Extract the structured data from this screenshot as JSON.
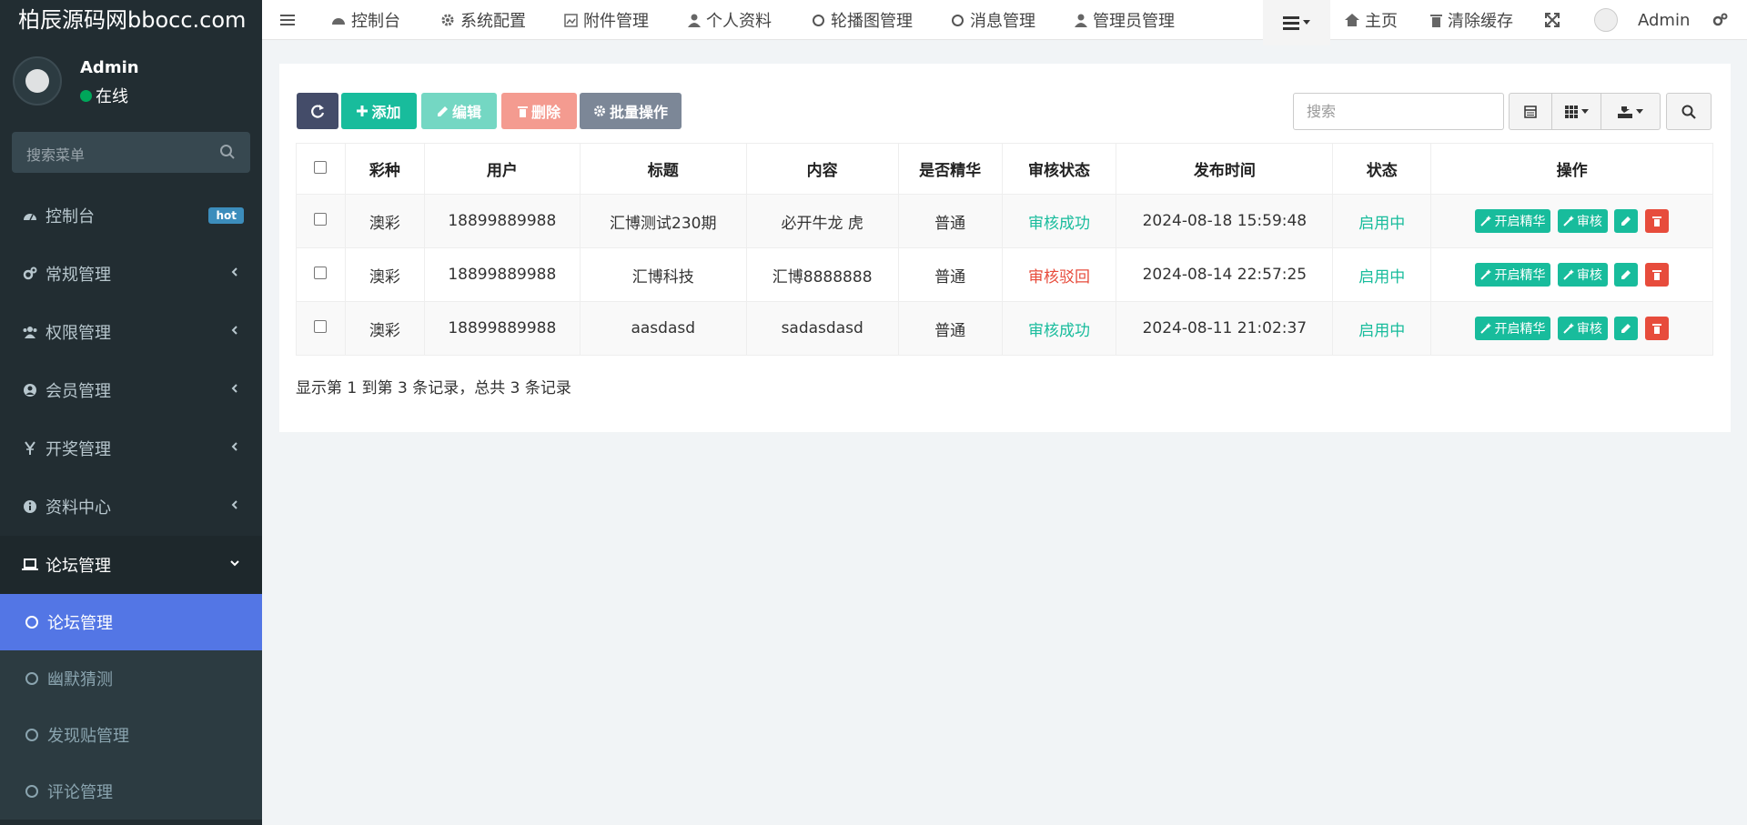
{
  "brand": "柏辰源码网bbocc.com",
  "user": {
    "name": "Admin",
    "status": "在线"
  },
  "sidebar": {
    "search_placeholder": "搜索菜单",
    "items": [
      {
        "label": "控制台",
        "badge": "hot"
      },
      {
        "label": "常规管理"
      },
      {
        "label": "权限管理"
      },
      {
        "label": "会员管理"
      },
      {
        "label": "开奖管理"
      },
      {
        "label": "资料中心"
      },
      {
        "label": "论坛管理"
      }
    ],
    "subitems": [
      {
        "label": "论坛管理"
      },
      {
        "label": "幽默猜测"
      },
      {
        "label": "发现贴管理"
      },
      {
        "label": "评论管理"
      }
    ]
  },
  "topnav": {
    "tabs": [
      "控制台",
      "系统配置",
      "附件管理",
      "个人资料",
      "轮播图管理",
      "消息管理",
      "管理员管理"
    ],
    "home": "主页",
    "clear_cache": "清除缓存",
    "admin": "Admin"
  },
  "toolbar": {
    "add": "添加",
    "edit": "编辑",
    "delete": "删除",
    "batch": "批量操作",
    "search_placeholder": "搜索"
  },
  "table": {
    "headers": [
      "彩种",
      "用户",
      "标题",
      "内容",
      "是否精华",
      "审核状态",
      "发布时间",
      "状态",
      "操作"
    ],
    "rows": [
      {
        "lottery": "澳彩",
        "user": "18899889988",
        "title": "汇博测试230期",
        "content": "必开牛龙 虎",
        "essence": "普通",
        "review": "审核成功",
        "time": "2024-08-18 15:59:48",
        "status": "启用中"
      },
      {
        "lottery": "澳彩",
        "user": "18899889988",
        "title": "汇博科技",
        "content": "汇博8888888",
        "essence": "普通",
        "review": "审核驳回",
        "time": "2024-08-14 22:57:25",
        "status": "启用中"
      },
      {
        "lottery": "澳彩",
        "user": "18899889988",
        "title": "aasdasd",
        "content": "sadasdasd",
        "essence": "普通",
        "review": "审核成功",
        "time": "2024-08-11 21:02:37",
        "status": "启用中"
      }
    ],
    "action_essence": "开启精华",
    "action_review": "审核"
  },
  "footer": "显示第 1 到第 3 条记录，总共 3 条记录"
}
